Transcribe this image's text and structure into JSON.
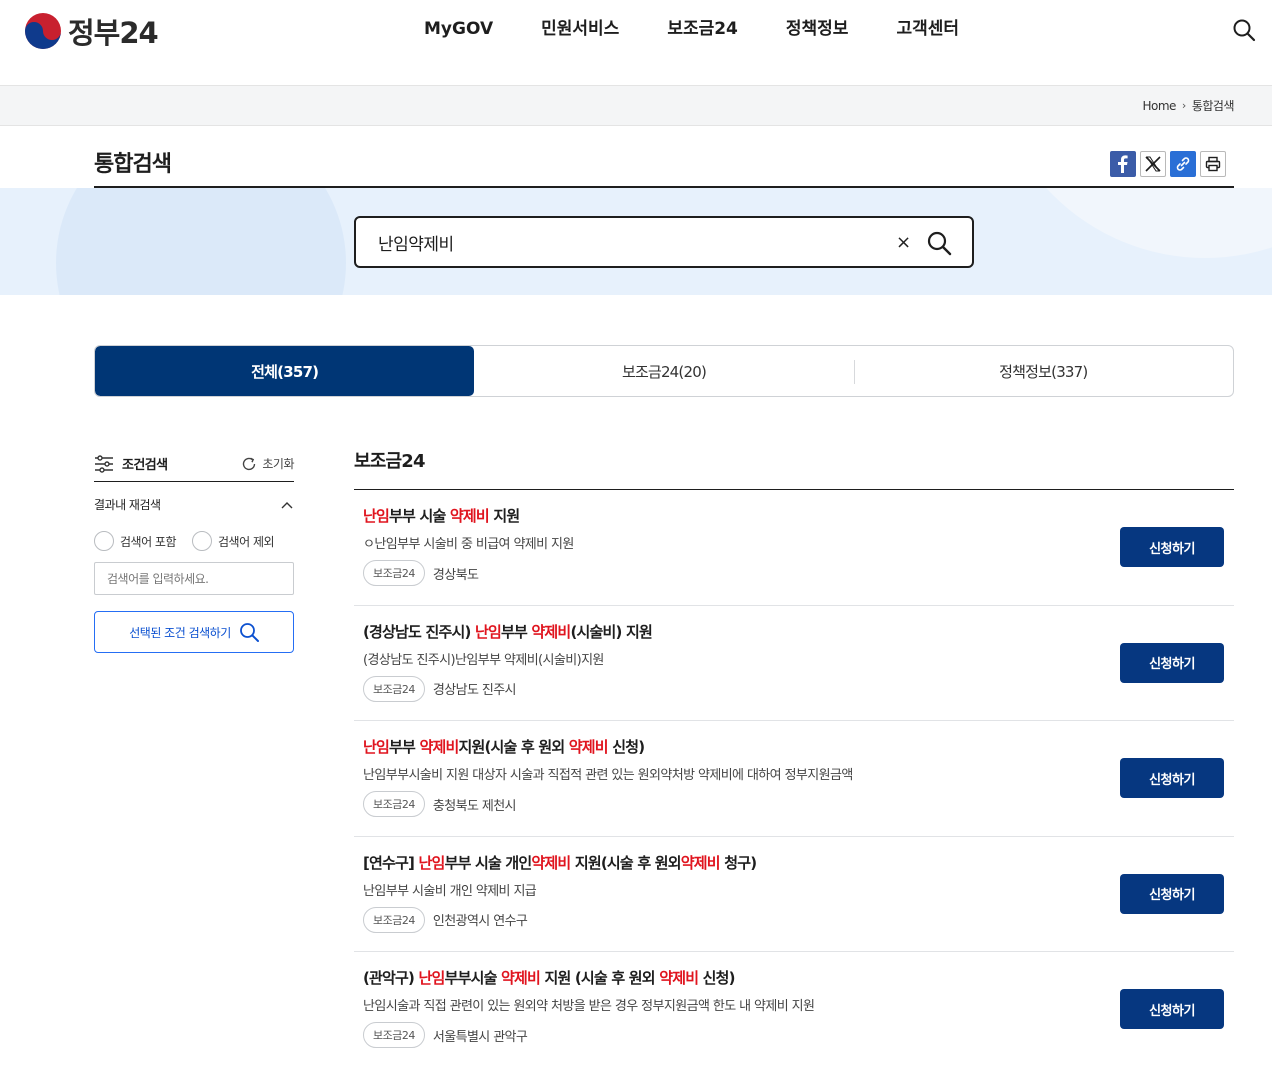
{
  "header": {
    "logo_text": "정부24",
    "nav": [
      "MyGOV",
      "민원서비스",
      "보조금24",
      "정책정보",
      "고객센터"
    ]
  },
  "breadcrumb": {
    "home": "Home",
    "current": "통합검색"
  },
  "page": {
    "title": "통합검색"
  },
  "search": {
    "value": "난임약제비",
    "clear_label": "×"
  },
  "tabs": [
    {
      "label": "전체(357)",
      "active": true
    },
    {
      "label": "보조금24(20)",
      "active": false
    },
    {
      "label": "정책정보(337)",
      "active": false
    }
  ],
  "sidebar": {
    "title": "조건검색",
    "reset_label": "초기화",
    "section_label": "결과내 재검색",
    "radio_include": "검색어 포함",
    "radio_exclude": "검색어 제외",
    "input_placeholder": "검색어를 입력하세요.",
    "search_button": "선택된 조건 검색하기"
  },
  "results": {
    "section_title": "보조금24",
    "apply_label": "신청하기",
    "items": [
      {
        "title_parts": [
          [
            "난임",
            true
          ],
          [
            "부부 시술 ",
            false
          ],
          [
            "약제비",
            true
          ],
          [
            " 지원",
            false
          ]
        ],
        "desc": "ㅇ난임부부 시술비 중 비급여 약제비 지원",
        "badge": "보조금24",
        "region": "경상북도"
      },
      {
        "title_parts": [
          [
            "(경상남도 진주시) ",
            false
          ],
          [
            "난임",
            true
          ],
          [
            "부부 ",
            false
          ],
          [
            "약제비",
            true
          ],
          [
            "(시술비) 지원",
            false
          ]
        ],
        "desc": "(경상남도 진주시)난임부부 약제비(시술비)지원",
        "badge": "보조금24",
        "region": "경상남도 진주시"
      },
      {
        "title_parts": [
          [
            "난임",
            true
          ],
          [
            "부부 ",
            false
          ],
          [
            "약제비",
            true
          ],
          [
            "지원(시술 후 원외 ",
            false
          ],
          [
            "약제비",
            true
          ],
          [
            " 신청)",
            false
          ]
        ],
        "desc": "난임부부시술비 지원 대상자 시술과 직접적 관련 있는 원외약처방 약제비에 대하여 정부지원금액",
        "badge": "보조금24",
        "region": "충청북도 제천시"
      },
      {
        "title_parts": [
          [
            "[연수구] ",
            false
          ],
          [
            "난임",
            true
          ],
          [
            "부부 시술 개인",
            false
          ],
          [
            "약제비",
            true
          ],
          [
            " 지원(시술 후 원외",
            false
          ],
          [
            "약제비",
            true
          ],
          [
            " 청구)",
            false
          ]
        ],
        "desc": "난임부부 시술비 개인 약제비 지급",
        "badge": "보조금24",
        "region": "인천광역시 연수구"
      },
      {
        "title_parts": [
          [
            "(관악구) ",
            false
          ],
          [
            "난임",
            true
          ],
          [
            "부부시술 ",
            false
          ],
          [
            "약제비",
            true
          ],
          [
            " 지원 (시술 후 원외 ",
            false
          ],
          [
            "약제비",
            true
          ],
          [
            " 신청)",
            false
          ]
        ],
        "desc": "난임시술과 직접 관련이 있는 원외약 처방을 받은 경우 정부지원금액 한도 내 약제비 지원",
        "badge": "보조금24",
        "region": "서울특별시 관악구"
      }
    ]
  },
  "colors": {
    "primary": "#003675",
    "highlight": "#e0141e",
    "band": "#e7f1fc",
    "link_blue": "#256ef4"
  },
  "icons": {
    "logo": "taegeuk-icon",
    "search": "search-icon",
    "facebook": "facebook-icon",
    "x": "x-icon",
    "link": "link-icon",
    "print": "print-icon",
    "filter": "filter-icon",
    "reset": "refresh-icon",
    "collapse": "chevron-up-icon"
  }
}
